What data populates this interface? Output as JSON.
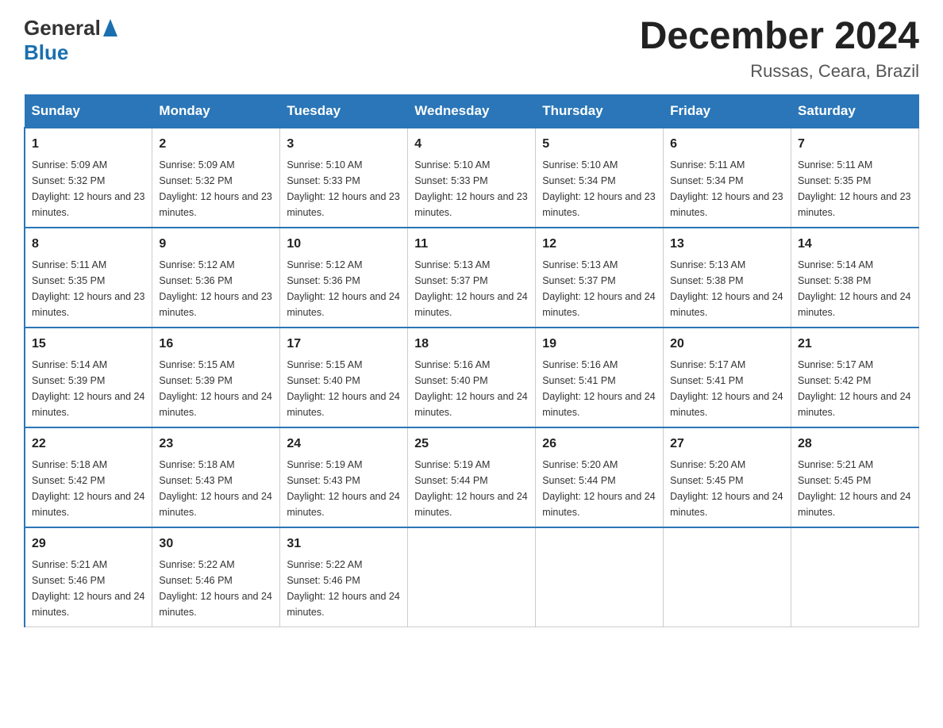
{
  "header": {
    "logo_text_general": "General",
    "logo_text_blue": "Blue",
    "month_title": "December 2024",
    "location": "Russas, Ceara, Brazil"
  },
  "days_of_week": [
    "Sunday",
    "Monday",
    "Tuesday",
    "Wednesday",
    "Thursday",
    "Friday",
    "Saturday"
  ],
  "weeks": [
    [
      {
        "day": "1",
        "sunrise": "5:09 AM",
        "sunset": "5:32 PM",
        "daylight": "12 hours and 23 minutes."
      },
      {
        "day": "2",
        "sunrise": "5:09 AM",
        "sunset": "5:32 PM",
        "daylight": "12 hours and 23 minutes."
      },
      {
        "day": "3",
        "sunrise": "5:10 AM",
        "sunset": "5:33 PM",
        "daylight": "12 hours and 23 minutes."
      },
      {
        "day": "4",
        "sunrise": "5:10 AM",
        "sunset": "5:33 PM",
        "daylight": "12 hours and 23 minutes."
      },
      {
        "day": "5",
        "sunrise": "5:10 AM",
        "sunset": "5:34 PM",
        "daylight": "12 hours and 23 minutes."
      },
      {
        "day": "6",
        "sunrise": "5:11 AM",
        "sunset": "5:34 PM",
        "daylight": "12 hours and 23 minutes."
      },
      {
        "day": "7",
        "sunrise": "5:11 AM",
        "sunset": "5:35 PM",
        "daylight": "12 hours and 23 minutes."
      }
    ],
    [
      {
        "day": "8",
        "sunrise": "5:11 AM",
        "sunset": "5:35 PM",
        "daylight": "12 hours and 23 minutes."
      },
      {
        "day": "9",
        "sunrise": "5:12 AM",
        "sunset": "5:36 PM",
        "daylight": "12 hours and 23 minutes."
      },
      {
        "day": "10",
        "sunrise": "5:12 AM",
        "sunset": "5:36 PM",
        "daylight": "12 hours and 24 minutes."
      },
      {
        "day": "11",
        "sunrise": "5:13 AM",
        "sunset": "5:37 PM",
        "daylight": "12 hours and 24 minutes."
      },
      {
        "day": "12",
        "sunrise": "5:13 AM",
        "sunset": "5:37 PM",
        "daylight": "12 hours and 24 minutes."
      },
      {
        "day": "13",
        "sunrise": "5:13 AM",
        "sunset": "5:38 PM",
        "daylight": "12 hours and 24 minutes."
      },
      {
        "day": "14",
        "sunrise": "5:14 AM",
        "sunset": "5:38 PM",
        "daylight": "12 hours and 24 minutes."
      }
    ],
    [
      {
        "day": "15",
        "sunrise": "5:14 AM",
        "sunset": "5:39 PM",
        "daylight": "12 hours and 24 minutes."
      },
      {
        "day": "16",
        "sunrise": "5:15 AM",
        "sunset": "5:39 PM",
        "daylight": "12 hours and 24 minutes."
      },
      {
        "day": "17",
        "sunrise": "5:15 AM",
        "sunset": "5:40 PM",
        "daylight": "12 hours and 24 minutes."
      },
      {
        "day": "18",
        "sunrise": "5:16 AM",
        "sunset": "5:40 PM",
        "daylight": "12 hours and 24 minutes."
      },
      {
        "day": "19",
        "sunrise": "5:16 AM",
        "sunset": "5:41 PM",
        "daylight": "12 hours and 24 minutes."
      },
      {
        "day": "20",
        "sunrise": "5:17 AM",
        "sunset": "5:41 PM",
        "daylight": "12 hours and 24 minutes."
      },
      {
        "day": "21",
        "sunrise": "5:17 AM",
        "sunset": "5:42 PM",
        "daylight": "12 hours and 24 minutes."
      }
    ],
    [
      {
        "day": "22",
        "sunrise": "5:18 AM",
        "sunset": "5:42 PM",
        "daylight": "12 hours and 24 minutes."
      },
      {
        "day": "23",
        "sunrise": "5:18 AM",
        "sunset": "5:43 PM",
        "daylight": "12 hours and 24 minutes."
      },
      {
        "day": "24",
        "sunrise": "5:19 AM",
        "sunset": "5:43 PM",
        "daylight": "12 hours and 24 minutes."
      },
      {
        "day": "25",
        "sunrise": "5:19 AM",
        "sunset": "5:44 PM",
        "daylight": "12 hours and 24 minutes."
      },
      {
        "day": "26",
        "sunrise": "5:20 AM",
        "sunset": "5:44 PM",
        "daylight": "12 hours and 24 minutes."
      },
      {
        "day": "27",
        "sunrise": "5:20 AM",
        "sunset": "5:45 PM",
        "daylight": "12 hours and 24 minutes."
      },
      {
        "day": "28",
        "sunrise": "5:21 AM",
        "sunset": "5:45 PM",
        "daylight": "12 hours and 24 minutes."
      }
    ],
    [
      {
        "day": "29",
        "sunrise": "5:21 AM",
        "sunset": "5:46 PM",
        "daylight": "12 hours and 24 minutes."
      },
      {
        "day": "30",
        "sunrise": "5:22 AM",
        "sunset": "5:46 PM",
        "daylight": "12 hours and 24 minutes."
      },
      {
        "day": "31",
        "sunrise": "5:22 AM",
        "sunset": "5:46 PM",
        "daylight": "12 hours and 24 minutes."
      },
      null,
      null,
      null,
      null
    ]
  ]
}
